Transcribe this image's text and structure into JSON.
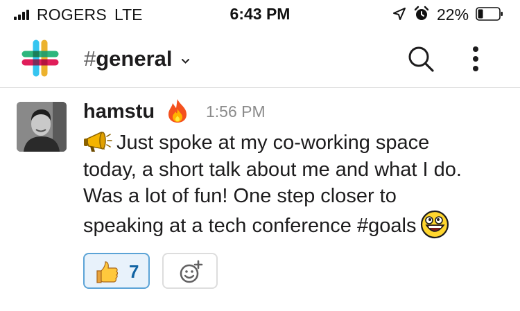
{
  "status_bar": {
    "carrier": "ROGERS",
    "network": "LTE",
    "time": "6:43 PM",
    "battery_percent": "22%",
    "battery_level": 0.22,
    "icons": [
      "signal-icon",
      "location-arrow-icon",
      "alarm-clock-icon",
      "battery-icon"
    ]
  },
  "header": {
    "hash": "#",
    "channel": "general",
    "icons": [
      "slack-logo",
      "chevron-down-icon",
      "search-icon",
      "more-vertical-icon"
    ]
  },
  "message": {
    "author": "hamstu",
    "author_status_emoji": "fire-icon",
    "timestamp": "1:56 PM",
    "lines": [
      "Just spoke at my co-working space",
      "today, a short talk about me and what I do.",
      "Was a lot of fun! One step closer to",
      "speaking at a tech conference #goals"
    ],
    "leading_emoji": "megaphone-icon",
    "trailing_emoji": "awesome-face-icon",
    "reactions": [
      {
        "emoji": "thumbs-up-icon",
        "count": "7",
        "selected": true
      }
    ],
    "add_reaction_icon": "add-emoji-icon"
  },
  "colors": {
    "link_blue": "#1264a3",
    "reaction_bg": "#e8f2fb",
    "reaction_border": "#5ba3d6",
    "muted_text": "#8b8b8b"
  }
}
